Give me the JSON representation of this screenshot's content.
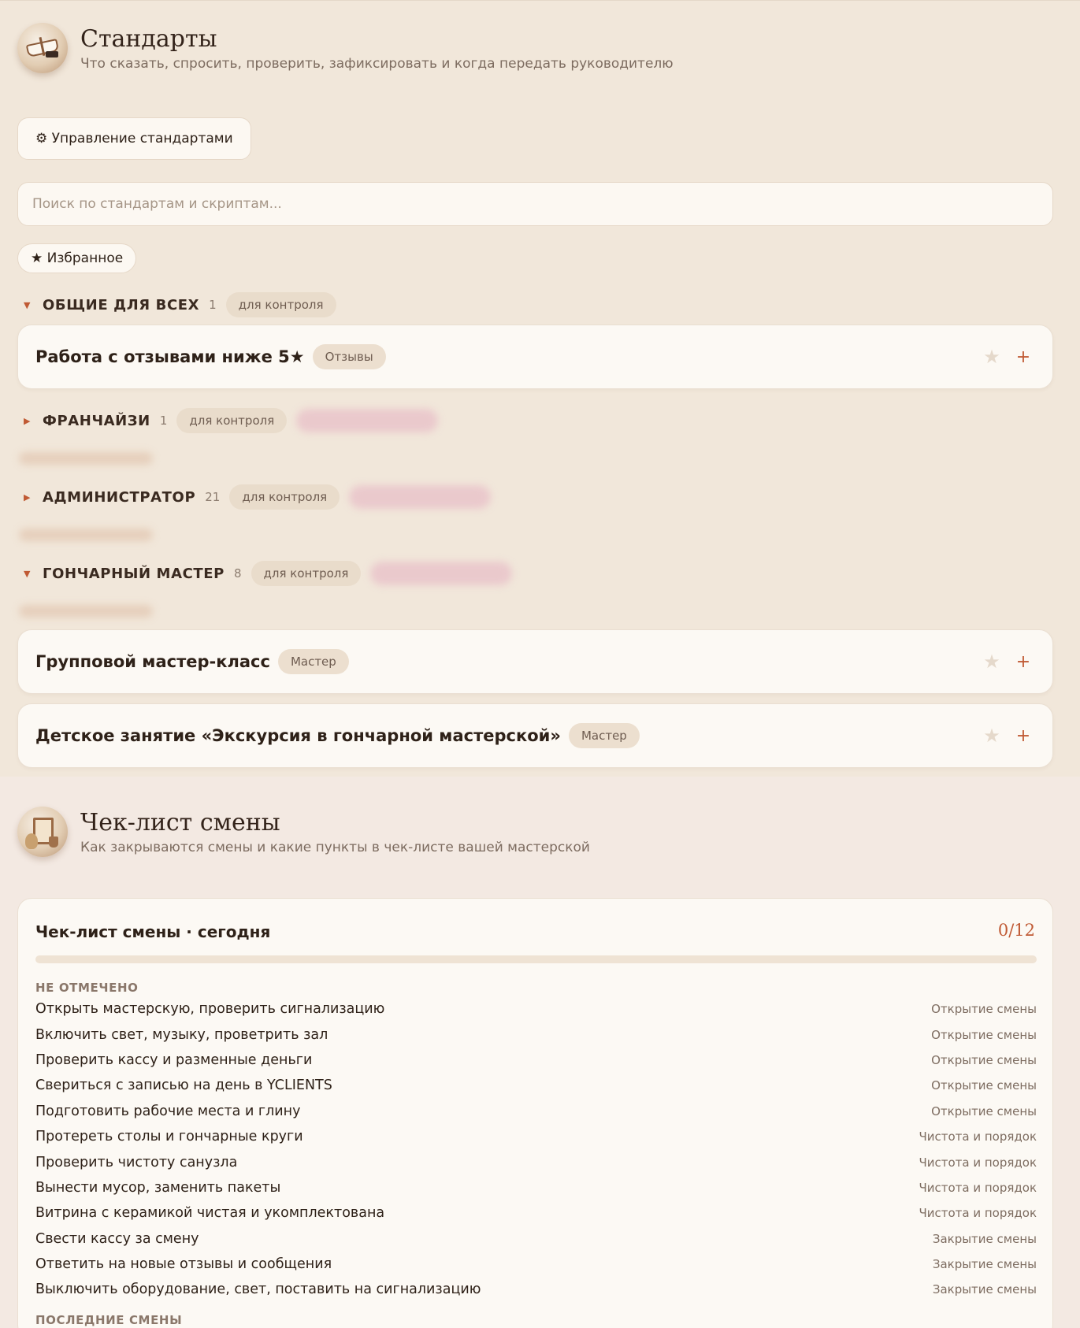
{
  "standards": {
    "title": "Стандарты",
    "subtitle": "Что сказать, спросить, проверить, зафиксировать и когда передать руководителю",
    "manage_button": "⚙ Управление стандартами",
    "search_placeholder": "Поиск по стандартам и скриптам...",
    "favorites_button": "★ Избранное",
    "groups": [
      {
        "name": "ОБЩИЕ ДЛЯ ВСЕХ",
        "count": "1",
        "tag": "для контроля",
        "expanded": true
      },
      {
        "name": "ФРАНЧАЙЗИ",
        "count": "1",
        "tag": "для контроля",
        "expanded": false
      },
      {
        "name": "АДМИНИСТРАТОР",
        "count": "21",
        "tag": "для контроля",
        "expanded": false
      },
      {
        "name": "ГОНЧАРНЫЙ МАСТЕР",
        "count": "8",
        "tag": "для контроля",
        "expanded": true
      }
    ],
    "cards": [
      {
        "title": "Работа с отзывами ниже 5★",
        "tag": "Отзывы",
        "star": "★",
        "add": "+"
      },
      {
        "title": "Групповой мастер-класс",
        "tag": "Мастер",
        "star": "★",
        "add": "+"
      },
      {
        "title": "Детское занятие «Экскурсия в гончарной мастерской»",
        "tag": "Мастер",
        "star": "★",
        "add": "+"
      }
    ],
    "caret_open": "▼",
    "caret_closed": "▶"
  },
  "checklist": {
    "title": "Чек-лист смены",
    "subtitle": "Как закрываются смены и какие пункты в чек-листе вашей мастерской",
    "card_title": "Чек-лист смены · сегодня",
    "progress_text": "0/12",
    "progress_fraction": 0,
    "unchecked_label": "НЕ ОТМЕЧЕНО",
    "recent_label": "ПОСЛЕДНИЕ СМЕНЫ",
    "items": [
      {
        "text": "Открыть мастерскую, проверить сигнализацию",
        "category": "Открытие смены"
      },
      {
        "text": "Включить свет, музыку, проветрить зал",
        "category": "Открытие смены"
      },
      {
        "text": "Проверить кассу и разменные деньги",
        "category": "Открытие смены"
      },
      {
        "text": "Свериться с записью на день в YCLIENTS",
        "category": "Открытие смены"
      },
      {
        "text": "Подготовить рабочие места и глину",
        "category": "Открытие смены"
      },
      {
        "text": "Протереть столы и гончарные круги",
        "category": "Чистота и порядок"
      },
      {
        "text": "Проверить чистоту санузла",
        "category": "Чистота и порядок"
      },
      {
        "text": "Вынести мусор, заменить пакеты",
        "category": "Чистота и порядок"
      },
      {
        "text": "Витрина с керамикой чистая и укомплектована",
        "category": "Чистота и порядок"
      },
      {
        "text": "Свести кассу за смену",
        "category": "Закрытие смены"
      },
      {
        "text": "Ответить на новые отзывы и сообщения",
        "category": "Закрытие смены"
      },
      {
        "text": "Выключить оборудование, свет, поставить на сигнализацию",
        "category": "Закрытие смены"
      }
    ]
  },
  "colors": {
    "accent": "#c05a34",
    "background": "#f1e7da",
    "card": "#fcf9f4"
  }
}
